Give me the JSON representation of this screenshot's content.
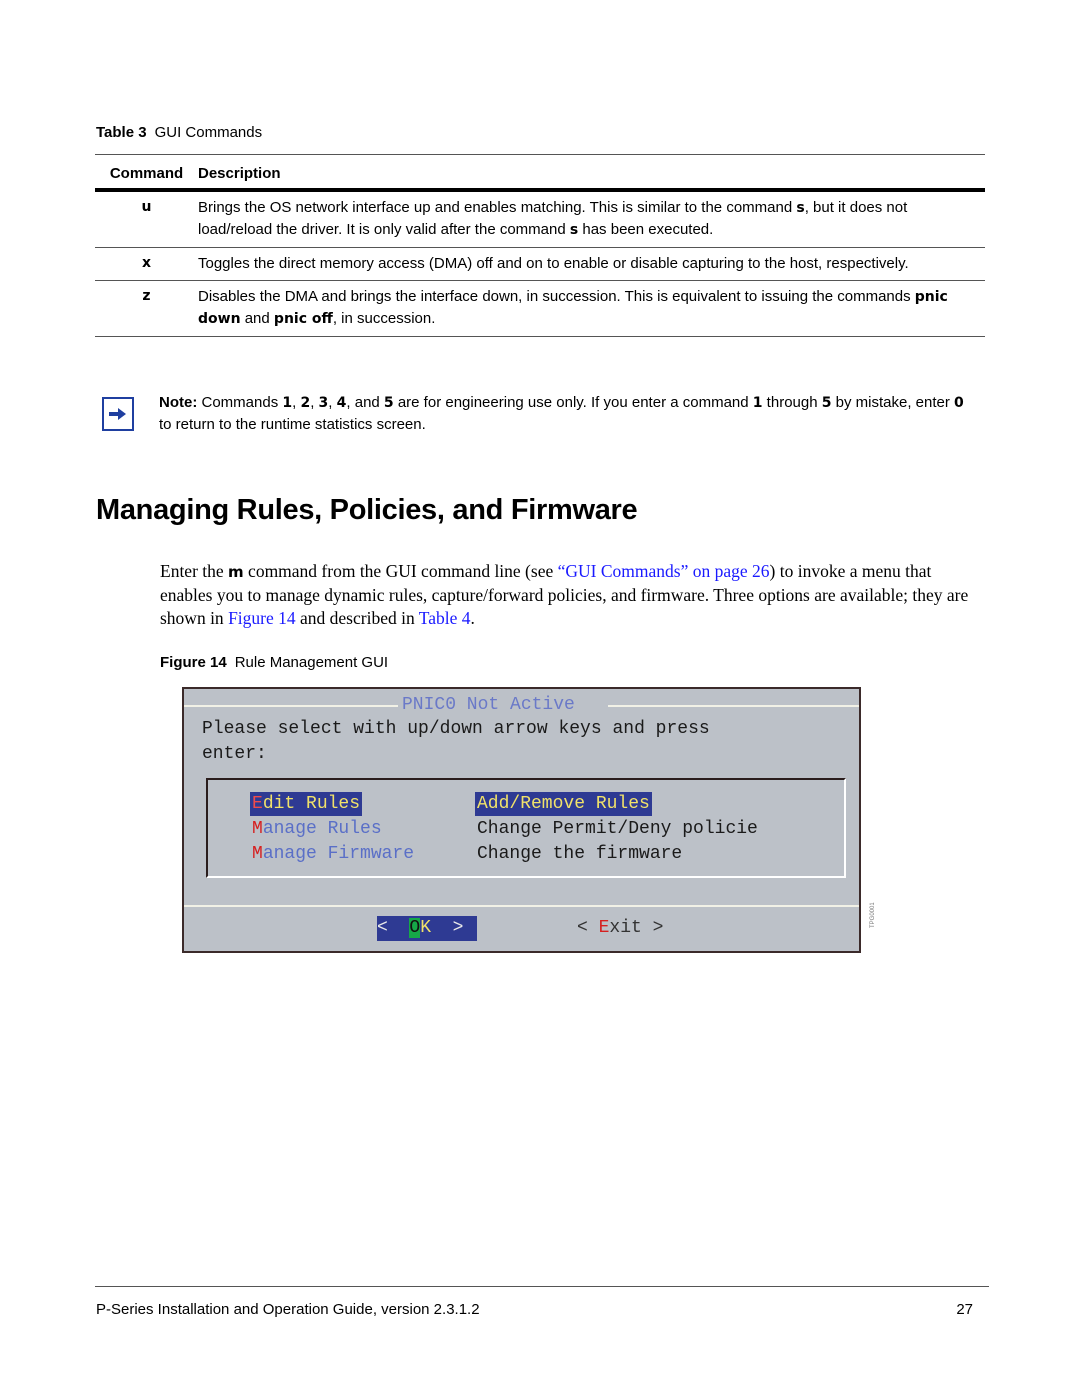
{
  "table": {
    "label": "Table 3",
    "title": "GUI Commands",
    "headers": [
      "Command",
      "Description"
    ],
    "rows": [
      {
        "command": "u",
        "desc_parts": [
          "Brings the OS network interface up and enables matching. This is similar to the command ",
          "s",
          ", but it does not load/reload the driver. It is only valid after the command ",
          "s",
          " has been executed."
        ]
      },
      {
        "command": "x",
        "desc_parts": [
          "Toggles the direct memory access (DMA) off and on to enable or disable capturing to the host, respectively."
        ]
      },
      {
        "command": "z",
        "desc_parts": [
          "Disables the DMA and brings the interface down, in succession. This is equivalent to issuing the commands ",
          "pnic down",
          " and ",
          "pnic off",
          ", in succession."
        ]
      }
    ]
  },
  "note": {
    "icon": "arrow-right-icon",
    "label": "Note:",
    "parts": [
      " Commands ",
      "1",
      ", ",
      "2",
      ", ",
      "3",
      ", ",
      "4",
      ", and ",
      "5",
      " are for engineering use only. If you enter a command ",
      "1",
      " through ",
      "5",
      " by mistake, enter ",
      "0",
      " to return to the runtime statistics screen."
    ]
  },
  "section": {
    "title": "Managing Rules, Policies, and Firmware",
    "para": {
      "t1": "Enter the ",
      "cmd": "m",
      "t2": " command from the GUI command line (see ",
      "link1": "“GUI Commands” on page 26",
      "t3": ") to invoke a menu that enables you to manage dynamic rules, capture/forward policies, and firmware. Three options are available; they are shown in ",
      "link2": "Figure 14",
      "t4": " and described in ",
      "link3": "Table 4",
      "t5": "."
    }
  },
  "figure": {
    "label": "Figure 14",
    "title": "Rule Management GUI",
    "id_text": "TPG0001",
    "terminal": {
      "title": "PNIC0 Not Active",
      "prompt_line1": "Please select with up/down arrow keys and press",
      "prompt_line2": "enter:",
      "items": [
        {
          "hotkey": "E",
          "rest": "dit Rules",
          "desc": "Add/Remove Rules",
          "selected": true
        },
        {
          "hotkey": "M",
          "rest": "anage Rules",
          "desc": "Change Permit/Deny policie",
          "selected": false
        },
        {
          "hotkey": "M",
          "rest": "anage Firmware",
          "desc": "Change the firmware",
          "selected": false
        }
      ],
      "ok_button": {
        "left": "<  ",
        "cursor": "O",
        "hot": "K",
        "right": "  >"
      },
      "exit_button": {
        "left": "< ",
        "hotkey": "E",
        "rest": "xit",
        "right": " >"
      }
    }
  },
  "footer": {
    "title": "P-Series Installation and Operation Guide, version 2.3.1.2",
    "page": "27"
  }
}
